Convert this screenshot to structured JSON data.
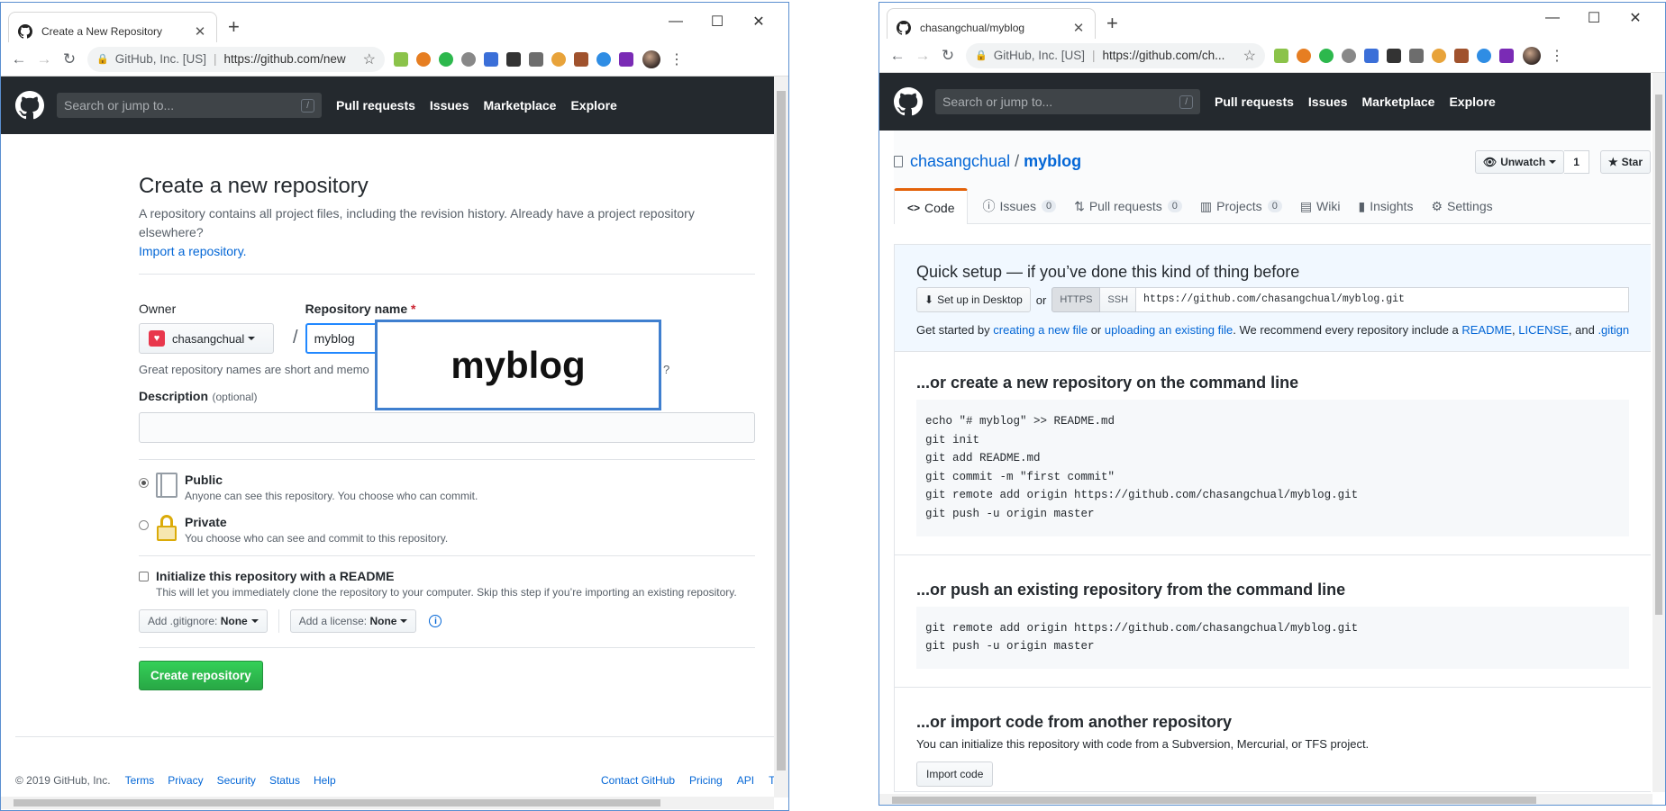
{
  "left": {
    "tab_title": "Create a New Repository",
    "omnibox": {
      "site": "GitHub, Inc. [US]",
      "url": "https://github.com/new"
    },
    "header": {
      "search_placeholder": "Search or jump to...",
      "slash": "/",
      "nav": [
        "Pull requests",
        "Issues",
        "Marketplace",
        "Explore"
      ]
    },
    "page_title": "Create a new repository",
    "intro": "A repository contains all project files, including the revision history. Already have a project repository elsewhere?",
    "import_link": "Import a repository.",
    "owner_label": "Owner",
    "owner_value": "chasangchual",
    "repo_name_label": "Repository name",
    "required_mark": "*",
    "repo_name_value": "myblog",
    "slash": "/",
    "hint_visible_start": "Great repository names are short and memo",
    "hint_visible_end": "?",
    "description_label": "Description",
    "description_optional": "(optional)",
    "public_label": "Public",
    "public_desc": "Anyone can see this repository. You choose who can commit.",
    "private_label": "Private",
    "private_desc": "You choose who can see and commit to this repository.",
    "readme_label": "Initialize this repository with a README",
    "readme_desc": "This will let you immediately clone the repository to your computer. Skip this step if you’re importing an existing repository.",
    "gitignore_prefix": "Add .gitignore:",
    "gitignore_value": "None",
    "license_prefix": "Add a license:",
    "license_value": "None",
    "info_icon": "i",
    "create_button": "Create repository",
    "footer_copyright": "© 2019 GitHub, Inc.",
    "footer_links": [
      "Terms",
      "Privacy",
      "Security",
      "Status",
      "Help"
    ],
    "footer_right": [
      "Contact GitHub",
      "Pricing",
      "API",
      "Tra"
    ],
    "callout_text": "myblog"
  },
  "right": {
    "tab_title": "chasangchual/myblog",
    "omnibox": {
      "site": "GitHub, Inc. [US]",
      "url": "https://github.com/ch..."
    },
    "header": {
      "search_placeholder": "Search or jump to...",
      "slash": "/",
      "nav": [
        "Pull requests",
        "Issues",
        "Marketplace",
        "Explore"
      ]
    },
    "owner": "chasangchual",
    "separator": "/",
    "repo": "myblog",
    "unwatch_label": "Unwatch",
    "watch_count": "1",
    "star_label": "Star",
    "tabs": [
      {
        "label": "Code",
        "count": ""
      },
      {
        "label": "Issues",
        "count": "0"
      },
      {
        "label": "Pull requests",
        "count": "0"
      },
      {
        "label": "Projects",
        "count": "0"
      },
      {
        "label": "Wiki",
        "count": ""
      },
      {
        "label": "Insights",
        "count": ""
      },
      {
        "label": "Settings",
        "count": ""
      }
    ],
    "code_glyph": "<>",
    "quick_setup_title": "Quick setup — if you’ve done this kind of thing before",
    "desktop_button": "Set up in Desktop",
    "or_text": "or",
    "https_label": "HTTPS",
    "ssh_label": "SSH",
    "clone_url": "https://github.com/chasangchual/myblog.git",
    "get_started": {
      "a": "Get started by",
      "link1": "creating a new file",
      "b": "or",
      "link2": "uploading an existing file",
      "c": ". We recommend every repository include a",
      "link3": "README",
      "d": ",",
      "link4": "LICENSE",
      "e": ", and",
      "link5": ".gitign"
    },
    "section_cmdline_title": "...or create a new repository on the command line",
    "cmdline_code": [
      "echo \"# myblog\" >> README.md",
      "git init",
      "git add README.md",
      "git commit -m \"first commit\"",
      "git remote add origin https://github.com/chasangchual/myblog.git",
      "git push -u origin master"
    ],
    "section_push_title": "...or push an existing repository from the command line",
    "push_code": [
      "git remote add origin https://github.com/chasangchual/myblog.git",
      "git push -u origin master"
    ],
    "section_import_title": "...or import code from another repository",
    "import_desc": "You can initialize this repository with code from a Subversion, Mercurial, or TFS project.",
    "import_button": "Import code"
  },
  "colors": {
    "header_bg": "#24292e",
    "link": "#0366d6",
    "primary_green": "#28a745",
    "window_border": "#5a8fd0",
    "callout_border": "#3f7fcf"
  }
}
